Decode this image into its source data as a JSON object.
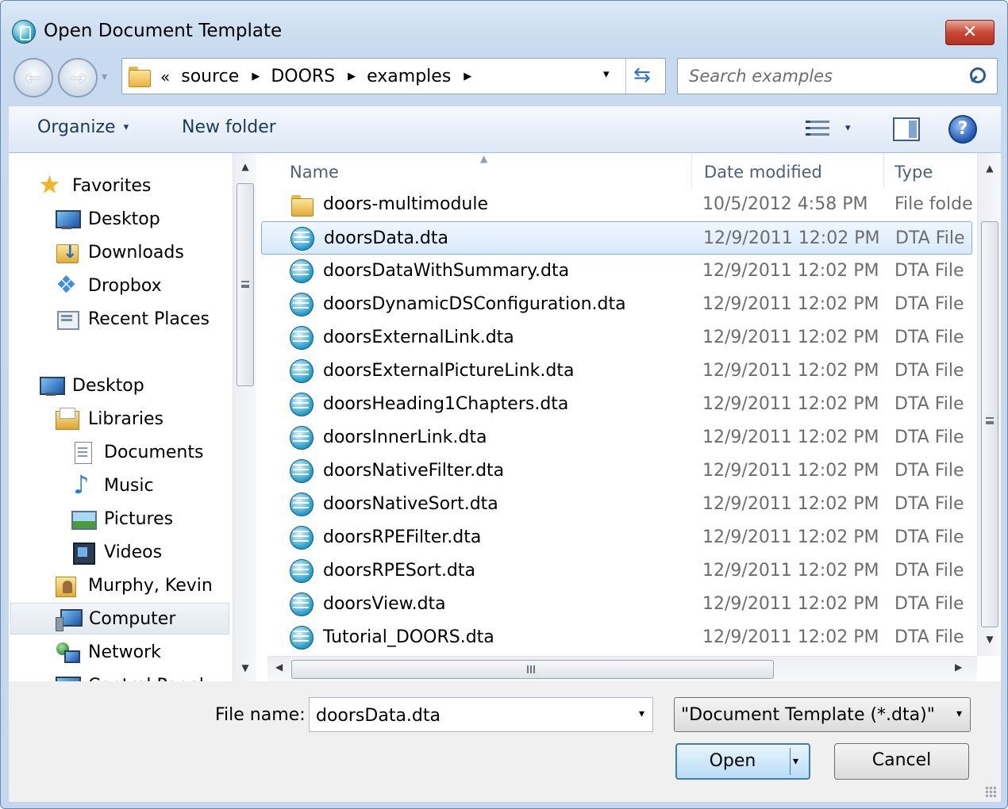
{
  "window": {
    "title": "Open Document Template",
    "close_label": "✕"
  },
  "nav": {
    "back_glyph": "←",
    "forward_glyph": "→",
    "history_glyph": "▾",
    "breadcrumb": {
      "overflow": "«",
      "items": [
        "source",
        "DOORS",
        "examples"
      ],
      "separator": "▶"
    },
    "address_dropdown_glyph": "▾",
    "refresh_glyph": "⇆"
  },
  "search": {
    "placeholder": "Search examples"
  },
  "toolbar": {
    "organize_label": "Organize",
    "organize_caret": "▾",
    "new_folder_label": "New folder",
    "view_caret": "▾",
    "help_label": "?"
  },
  "sidebar": {
    "items": [
      {
        "label": "Favorites",
        "icon": "star-icon"
      },
      {
        "label": "Desktop",
        "icon": "desktop-icon"
      },
      {
        "label": "Downloads",
        "icon": "downloads-folder-icon"
      },
      {
        "label": "Dropbox",
        "icon": "dropbox-icon"
      },
      {
        "label": "Recent Places",
        "icon": "recent-places-icon"
      },
      {
        "label": "Desktop",
        "icon": "desktop-icon"
      },
      {
        "label": "Libraries",
        "icon": "libraries-icon"
      },
      {
        "label": "Documents",
        "icon": "documents-icon"
      },
      {
        "label": "Music",
        "icon": "music-icon"
      },
      {
        "label": "Pictures",
        "icon": "pictures-icon"
      },
      {
        "label": "Videos",
        "icon": "videos-icon"
      },
      {
        "label": "Murphy, Kevin",
        "icon": "user-folder-icon"
      },
      {
        "label": "Computer",
        "icon": "computer-icon",
        "selected": true
      },
      {
        "label": "Network",
        "icon": "network-icon"
      },
      {
        "label": "Control Panel",
        "icon": "control-panel-icon"
      }
    ]
  },
  "columns": {
    "name": "Name",
    "date": "Date modified",
    "type": "Type"
  },
  "files": [
    {
      "name": "doors-multimodule",
      "date": "10/5/2012 4:58 PM",
      "type": "File folde",
      "kind": "folder"
    },
    {
      "name": "doorsData.dta",
      "date": "12/9/2011 12:02 PM",
      "type": "DTA File",
      "kind": "dta",
      "selected": true
    },
    {
      "name": "doorsDataWithSummary.dta",
      "date": "12/9/2011 12:02 PM",
      "type": "DTA File",
      "kind": "dta"
    },
    {
      "name": "doorsDynamicDSConfiguration.dta",
      "date": "12/9/2011 12:02 PM",
      "type": "DTA File",
      "kind": "dta"
    },
    {
      "name": "doorsExternalLink.dta",
      "date": "12/9/2011 12:02 PM",
      "type": "DTA File",
      "kind": "dta"
    },
    {
      "name": "doorsExternalPictureLink.dta",
      "date": "12/9/2011 12:02 PM",
      "type": "DTA File",
      "kind": "dta"
    },
    {
      "name": "doorsHeading1Chapters.dta",
      "date": "12/9/2011 12:02 PM",
      "type": "DTA File",
      "kind": "dta"
    },
    {
      "name": "doorsInnerLink.dta",
      "date": "12/9/2011 12:02 PM",
      "type": "DTA File",
      "kind": "dta"
    },
    {
      "name": "doorsNativeFilter.dta",
      "date": "12/9/2011 12:02 PM",
      "type": "DTA File",
      "kind": "dta"
    },
    {
      "name": "doorsNativeSort.dta",
      "date": "12/9/2011 12:02 PM",
      "type": "DTA File",
      "kind": "dta"
    },
    {
      "name": "doorsRPEFilter.dta",
      "date": "12/9/2011 12:02 PM",
      "type": "DTA File",
      "kind": "dta"
    },
    {
      "name": "doorsRPESort.dta",
      "date": "12/9/2011 12:02 PM",
      "type": "DTA File",
      "kind": "dta"
    },
    {
      "name": "doorsView.dta",
      "date": "12/9/2011 12:02 PM",
      "type": "DTA File",
      "kind": "dta"
    },
    {
      "name": "Tutorial_DOORS.dta",
      "date": "12/9/2011 12:02 PM",
      "type": "DTA File",
      "kind": "dta"
    }
  ],
  "footer": {
    "file_name_label": "File name:",
    "file_name_value": "doorsData.dta",
    "file_type_value": "\"Document Template (*.dta)\"",
    "open_label": "Open",
    "cancel_label": "Cancel",
    "dropdown_glyph": "▾"
  },
  "scroll": {
    "up": "▲",
    "down": "▼",
    "left": "◀",
    "right": "▶"
  }
}
